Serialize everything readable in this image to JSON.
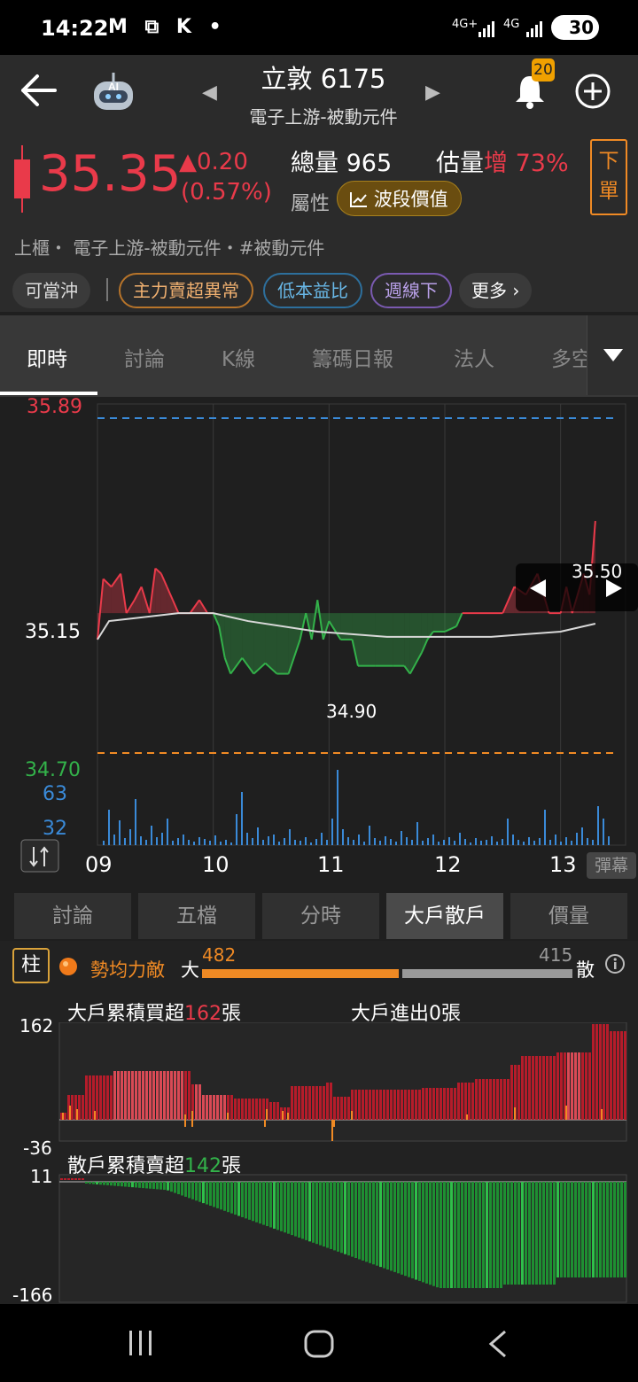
{
  "status_bar": {
    "time": "14:22",
    "icons": "M ⧉ K •",
    "net1": "4G+",
    "net2": "4G",
    "battery": "30"
  },
  "header": {
    "stock_name_code": "立敦 6175",
    "sector": "電子上游-被動元件",
    "notifications_count": "20"
  },
  "quote": {
    "price": "35.35",
    "change": "▲0.20",
    "change_pct": "(0.57%)",
    "total_volume_label": "總量",
    "total_volume": "965",
    "est_label": "估量",
    "est_dir": "增",
    "est_pct": "73%",
    "attr_label": "屬性",
    "wave_btn": "波段價值",
    "order_btn": "下單"
  },
  "category_line": "上櫃・ 電子上游-被動元件・#被動元件",
  "chips": [
    {
      "label": "可當沖"
    },
    {
      "label": "主力賣超異常"
    },
    {
      "label": "低本益比"
    },
    {
      "label": "週線下"
    },
    {
      "label": "更多 ›"
    }
  ],
  "tabs": [
    "即時",
    "討論",
    "K線",
    "籌碼日報",
    "法人",
    "多空"
  ],
  "chart": {
    "high_label": "35.89",
    "ref_label": "35.15",
    "low_label": "34.70",
    "min_marker": "34.90",
    "last_marker": "35.50",
    "vol_high": "63",
    "vol_mid": "32",
    "x_ticks": [
      "09",
      "10",
      "11",
      "12",
      "13"
    ],
    "danmu": "彈幕"
  },
  "chart_data": {
    "type": "line",
    "x_range": [
      "09:00",
      "13:30"
    ],
    "ylim": [
      34.7,
      35.89
    ],
    "reference": 35.15,
    "price_series": [
      [
        9.0,
        35.05
      ],
      [
        9.05,
        35.28
      ],
      [
        9.12,
        35.25
      ],
      [
        9.2,
        35.3
      ],
      [
        9.25,
        35.15
      ],
      [
        9.32,
        35.2
      ],
      [
        9.38,
        35.25
      ],
      [
        9.45,
        35.15
      ],
      [
        9.5,
        35.32
      ],
      [
        9.55,
        35.3
      ],
      [
        9.6,
        35.25
      ],
      [
        9.65,
        35.2
      ],
      [
        9.7,
        35.15
      ],
      [
        9.8,
        35.15
      ],
      [
        9.88,
        35.2
      ],
      [
        9.95,
        35.15
      ],
      [
        10.0,
        35.15
      ],
      [
        10.05,
        35.1
      ],
      [
        10.1,
        34.98
      ],
      [
        10.15,
        34.92
      ],
      [
        10.25,
        34.98
      ],
      [
        10.35,
        34.92
      ],
      [
        10.45,
        34.96
      ],
      [
        10.55,
        34.92
      ],
      [
        10.65,
        34.92
      ],
      [
        10.75,
        35.05
      ],
      [
        10.8,
        35.15
      ],
      [
        10.85,
        35.05
      ],
      [
        10.9,
        35.2
      ],
      [
        10.95,
        35.05
      ],
      [
        11.0,
        35.12
      ],
      [
        11.1,
        35.05
      ],
      [
        11.2,
        35.05
      ],
      [
        11.25,
        34.95
      ],
      [
        11.4,
        34.95
      ],
      [
        11.55,
        34.95
      ],
      [
        11.65,
        34.95
      ],
      [
        11.7,
        34.92
      ],
      [
        11.8,
        35.0
      ],
      [
        11.85,
        35.05
      ],
      [
        11.9,
        35.08
      ],
      [
        12.0,
        35.08
      ],
      [
        12.1,
        35.1
      ],
      [
        12.15,
        35.15
      ],
      [
        12.5,
        35.15
      ],
      [
        12.6,
        35.25
      ],
      [
        12.7,
        35.22
      ],
      [
        12.8,
        35.3
      ],
      [
        12.9,
        35.15
      ],
      [
        13.0,
        35.15
      ],
      [
        13.05,
        35.25
      ],
      [
        13.1,
        35.15
      ],
      [
        13.2,
        35.3
      ],
      [
        13.25,
        35.22
      ],
      [
        13.3,
        35.5
      ]
    ],
    "avg_series": [
      [
        9.0,
        35.05
      ],
      [
        9.1,
        35.12
      ],
      [
        9.3,
        35.13
      ],
      [
        9.5,
        35.14
      ],
      [
        9.7,
        35.15
      ],
      [
        10.0,
        35.15
      ],
      [
        10.3,
        35.12
      ],
      [
        10.6,
        35.1
      ],
      [
        10.9,
        35.08
      ],
      [
        11.2,
        35.07
      ],
      [
        11.5,
        35.06
      ],
      [
        11.8,
        35.06
      ],
      [
        12.1,
        35.06
      ],
      [
        12.4,
        35.06
      ],
      [
        12.7,
        35.07
      ],
      [
        13.0,
        35.08
      ],
      [
        13.3,
        35.11
      ]
    ],
    "volume_scale": [
      32,
      63
    ]
  },
  "sub_tabs": [
    "討論",
    "五檔",
    "分時",
    "大戶散戶",
    "價量"
  ],
  "big_small": {
    "col_btn": "柱",
    "status": "勢均力敵",
    "big_label": "大",
    "small_label": "散",
    "big_value": "482",
    "small_value": "415",
    "big_ratio": 0.537,
    "big_title_prefix": "大戶累積買超",
    "big_title_value": "162",
    "unit": "張",
    "big_inout": "大戶進出0張",
    "big_ymax": "162",
    "big_ymin": "-36",
    "small_title_prefix": "散戶累積賣超",
    "small_title_value": "142",
    "small_ymax": "11",
    "small_ymin": "-166"
  },
  "colors": {
    "up": "#e93a4a",
    "down": "#33b24a",
    "accent": "#f08a24",
    "blue": "#3a8ad8"
  }
}
